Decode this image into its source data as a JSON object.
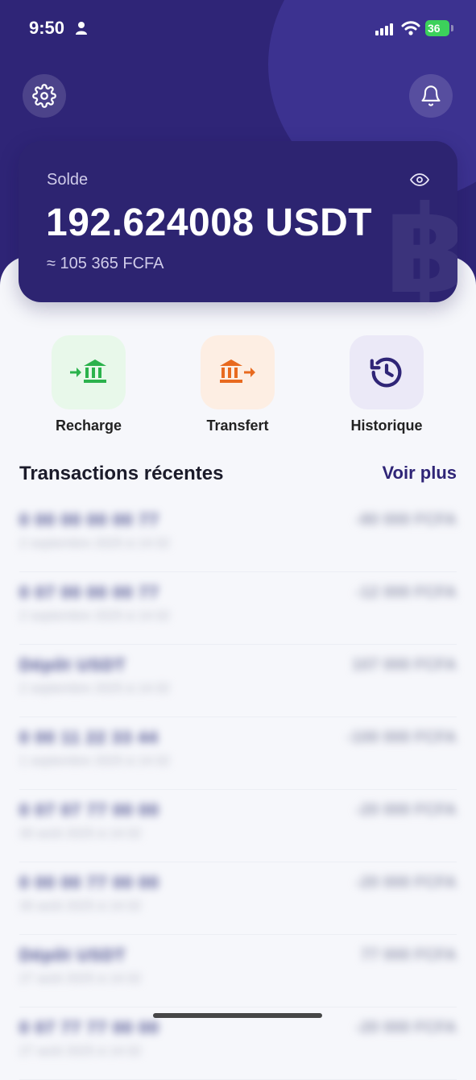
{
  "status_bar": {
    "time": "9:50",
    "battery": "36"
  },
  "header": {
    "settings_icon": "gear-icon",
    "notifications_icon": "bell-icon"
  },
  "balance_card": {
    "label": "Solde",
    "amount": "192.624008 USDT",
    "converted": "≈ 105 365 FCFA",
    "visibility_icon": "eye-icon"
  },
  "actions": [
    {
      "label": "Recharge",
      "icon": "bank-deposit-icon",
      "color": "#2bb24c"
    },
    {
      "label": "Transfert",
      "icon": "bank-transfer-icon",
      "color": "#e86a1f"
    },
    {
      "label": "Historique",
      "icon": "history-icon",
      "color": "#2f2577"
    }
  ],
  "transactions_section": {
    "title": "Transactions récentes",
    "see_more": "Voir plus"
  },
  "transactions": [
    {
      "title": "0 00 00 00 00 77",
      "date": "2 septembre 2025 à 14:32",
      "amount": "-80 000 FCFA"
    },
    {
      "title": "0 07 00 00 00 77",
      "date": "2 septembre 2025 à 14:32",
      "amount": "-12 000 FCFA"
    },
    {
      "title": "Dépôt USDT",
      "date": "2 septembre 2025 à 14:32",
      "amount": "107 000 FCFA"
    },
    {
      "title": "0 00 11 22 33 44",
      "date": "1 septembre 2025 à 14:32",
      "amount": "-100 000 FCFA"
    },
    {
      "title": "0 07 07 77 00 00",
      "date": "30 août 2025 à 14:32",
      "amount": "-20 000 FCFA"
    },
    {
      "title": "0 00 00 77 00 00",
      "date": "30 août 2025 à 14:32",
      "amount": "-20 000 FCFA"
    },
    {
      "title": "Dépôt USDT",
      "date": "27 août 2025 à 14:32",
      "amount": "77 000 FCFA"
    },
    {
      "title": "0 07 77 77 00 00",
      "date": "27 août 2025 à 14:32",
      "amount": "-20 000 FCFA"
    }
  ],
  "colors": {
    "brand": "#2f2577",
    "recharge_tile": "#e8f8ea",
    "transfer_tile": "#fdeee3",
    "history_tile": "#ebe9f7"
  }
}
